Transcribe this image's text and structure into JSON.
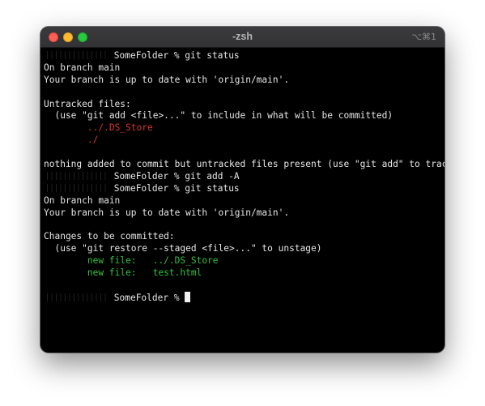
{
  "window": {
    "title": "-zsh",
    "shortcut": "⌥⌘1"
  },
  "terminal": {
    "lines": [
      {
        "prompt_suffix": "SomeFolder % git status"
      },
      {
        "text": "On branch main"
      },
      {
        "text": "Your branch is up to date with 'origin/main'."
      },
      {
        "text": ""
      },
      {
        "text": "Untracked files:"
      },
      {
        "text": "  (use \"git add <file>...\" to include in what will be committed)"
      },
      {
        "indent": "        ",
        "text": "../.DS_Store",
        "color": "red"
      },
      {
        "indent": "        ",
        "text": "./",
        "color": "red"
      },
      {
        "text": ""
      },
      {
        "text": "nothing added to commit but untracked files present (use \"git add\" to track)"
      },
      {
        "prompt_suffix": "SomeFolder % git add -A"
      },
      {
        "prompt_suffix": "SomeFolder % git status"
      },
      {
        "text": "On branch main"
      },
      {
        "text": "Your branch is up to date with 'origin/main'."
      },
      {
        "text": ""
      },
      {
        "text": "Changes to be committed:"
      },
      {
        "text": "  (use \"git restore --staged <file>...\" to unstage)"
      },
      {
        "indent": "        ",
        "text": "new file:   ../.DS_Store",
        "color": "green"
      },
      {
        "indent": "        ",
        "text": "new file:   test.html",
        "color": "green"
      },
      {
        "text": ""
      },
      {
        "prompt_suffix": "SomeFolder % ",
        "cursor": true
      }
    ]
  },
  "colors": {
    "background": "#000000",
    "foreground": "#e6e6e6",
    "red": "#d6372e",
    "green": "#33c23e",
    "close": "#ff5f57",
    "minimize": "#febc2e",
    "zoom": "#28c840"
  }
}
